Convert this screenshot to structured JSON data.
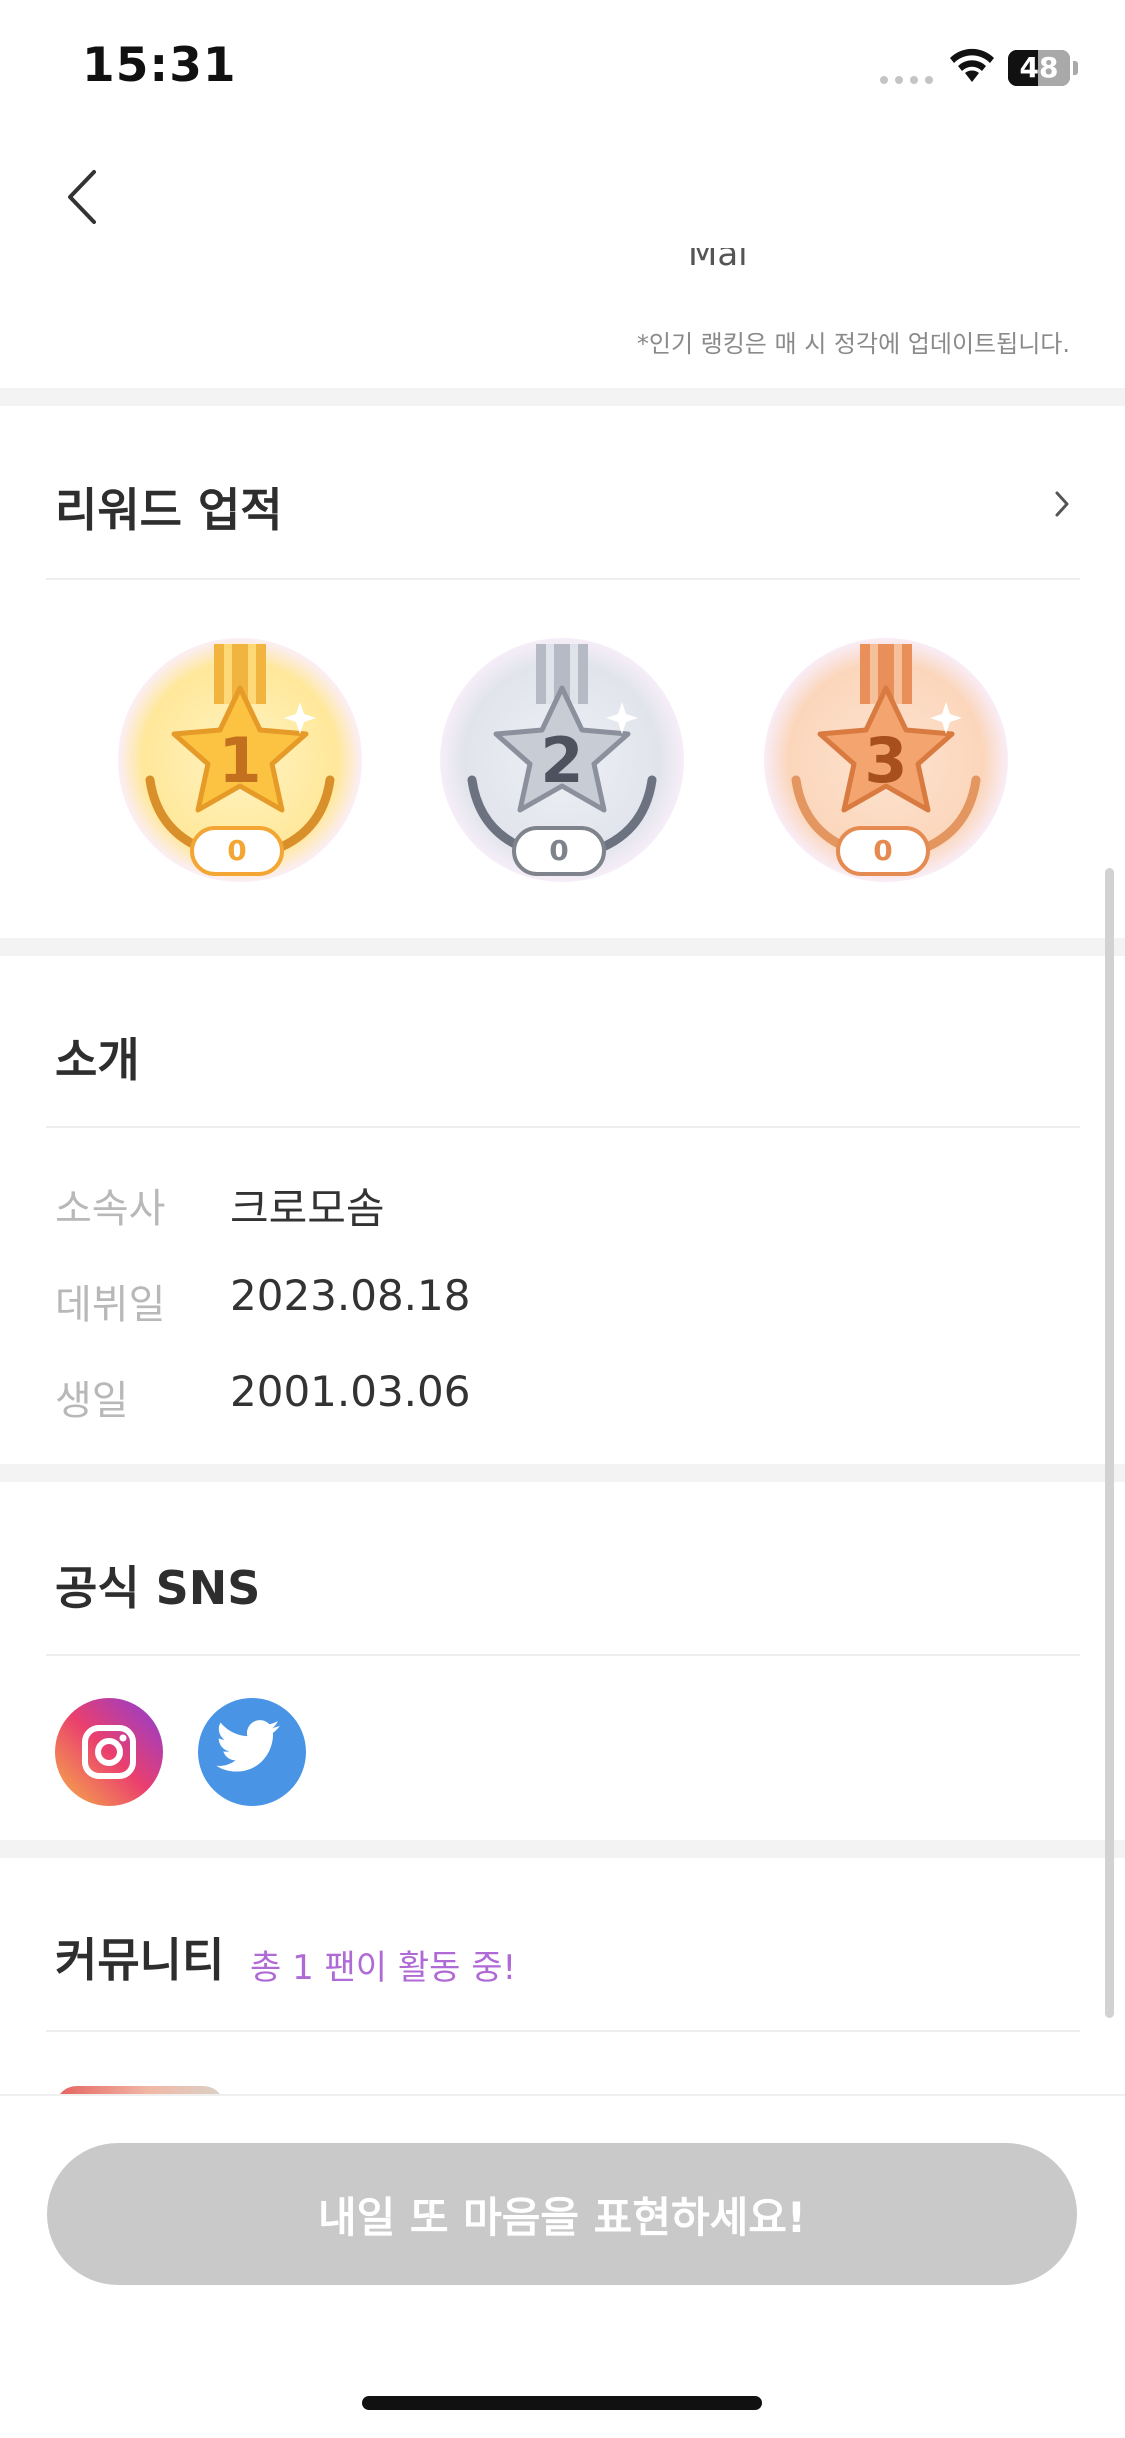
{
  "status_bar": {
    "time": "15:31",
    "battery_level": "48"
  },
  "header": {
    "partial_text": "Mai",
    "ranking_note": "*인기 랭킹은 매 시 정각에 업데이트됩니다."
  },
  "rewards": {
    "title": "리워드 업적",
    "medals": [
      {
        "rank": "1",
        "count": "0",
        "color": "#f3a634"
      },
      {
        "rank": "2",
        "count": "0",
        "color": "#7e838c"
      },
      {
        "rank": "3",
        "count": "0",
        "color": "#e58a50"
      }
    ]
  },
  "intro": {
    "title": "소개",
    "rows": [
      {
        "label": "소속사",
        "value": "크로모솜"
      },
      {
        "label": "데뷔일",
        "value": "2023.08.18"
      },
      {
        "label": "생일",
        "value": "2001.03.06"
      }
    ]
  },
  "sns": {
    "title": "공식 SNS",
    "icons": [
      "instagram-icon",
      "twitter-icon"
    ]
  },
  "community": {
    "title": "커뮤니티",
    "subtitle": "총 1 팬이 활동 중!"
  },
  "cta": {
    "label": "내일 또 마음을 표현하세요!"
  },
  "colors": {
    "accent": "#b06ad6",
    "disabled": "#c9c9c9",
    "twitter": "#4a94e6"
  }
}
